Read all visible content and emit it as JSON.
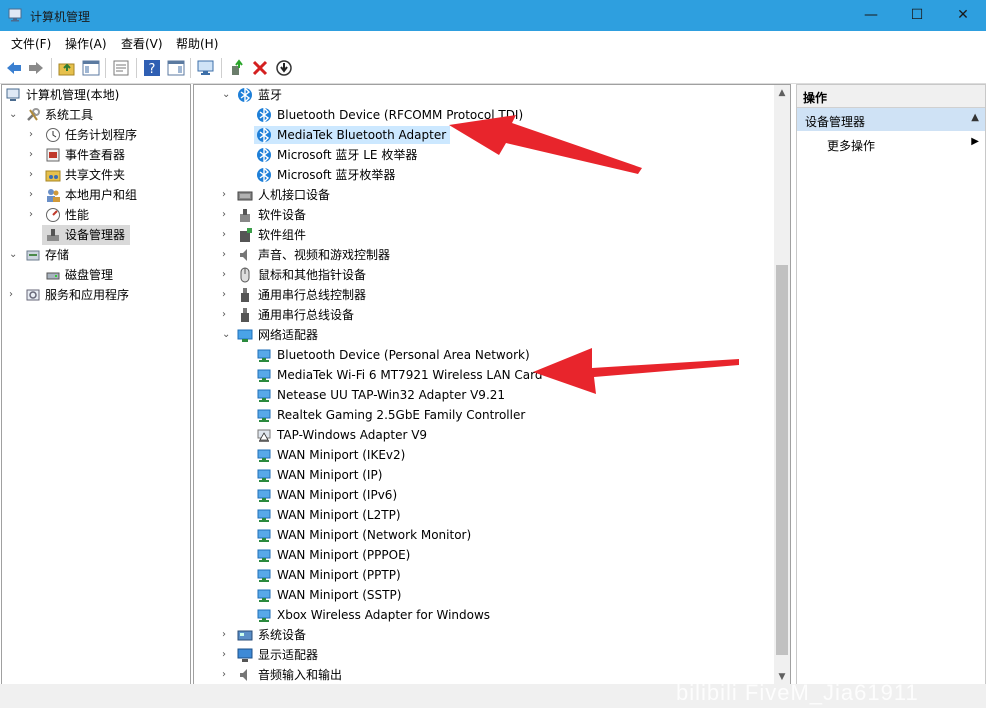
{
  "window": {
    "title": "计算机管理",
    "controls": {
      "minimize": "—",
      "maximize": "☐",
      "close": "✕"
    }
  },
  "menu": [
    "文件(F)",
    "操作(A)",
    "查看(V)",
    "帮助(H)"
  ],
  "left_tree": [
    {
      "label": "计算机管理(本地)",
      "icon": "computer-management-icon"
    },
    {
      "label": "系统工具",
      "icon": "tools-icon"
    },
    {
      "label": "任务计划程序",
      "icon": "clock-icon"
    },
    {
      "label": "事件查看器",
      "icon": "event-viewer-icon"
    },
    {
      "label": "共享文件夹",
      "icon": "shared-folder-icon"
    },
    {
      "label": "本地用户和组",
      "icon": "users-icon"
    },
    {
      "label": "性能",
      "icon": "performance-icon"
    },
    {
      "label": "设备管理器",
      "icon": "device-manager-icon"
    },
    {
      "label": "存储",
      "icon": "storage-icon"
    },
    {
      "label": "磁盘管理",
      "icon": "disk-icon"
    },
    {
      "label": "服务和应用程序",
      "icon": "services-icon"
    }
  ],
  "device_tree": [
    {
      "label": "蓝牙",
      "icon": "bluetooth-icon"
    },
    {
      "label": "Bluetooth Device (RFCOMM Protocol TDI)",
      "icon": "bluetooth-icon"
    },
    {
      "label": "MediaTek Bluetooth Adapter",
      "icon": "bluetooth-icon"
    },
    {
      "label": "Microsoft 蓝牙 LE 枚举器",
      "icon": "bluetooth-icon"
    },
    {
      "label": "Microsoft 蓝牙枚举器",
      "icon": "bluetooth-icon"
    },
    {
      "label": "人机接口设备",
      "icon": "hid-icon"
    },
    {
      "label": "软件设备",
      "icon": "software-device-icon"
    },
    {
      "label": "软件组件",
      "icon": "software-component-icon"
    },
    {
      "label": "声音、视频和游戏控制器",
      "icon": "speaker-icon"
    },
    {
      "label": "鼠标和其他指针设备",
      "icon": "mouse-icon"
    },
    {
      "label": "通用串行总线控制器",
      "icon": "usb-icon"
    },
    {
      "label": "通用串行总线设备",
      "icon": "usb-icon"
    },
    {
      "label": "网络适配器",
      "icon": "network-icon"
    },
    {
      "label": "Bluetooth Device (Personal Area Network)",
      "icon": "network-adapter-icon"
    },
    {
      "label": "MediaTek Wi-Fi 6 MT7921 Wireless LAN Card",
      "icon": "network-adapter-icon"
    },
    {
      "label": "Netease UU TAP-Win32 Adapter V9.21",
      "icon": "network-adapter-icon"
    },
    {
      "label": "Realtek Gaming 2.5GbE Family Controller",
      "icon": "network-adapter-icon"
    },
    {
      "label": "TAP-Windows Adapter V9",
      "icon": "network-adapter-warning-icon"
    },
    {
      "label": "WAN Miniport (IKEv2)",
      "icon": "network-adapter-icon"
    },
    {
      "label": "WAN Miniport (IP)",
      "icon": "network-adapter-icon"
    },
    {
      "label": "WAN Miniport (IPv6)",
      "icon": "network-adapter-icon"
    },
    {
      "label": "WAN Miniport (L2TP)",
      "icon": "network-adapter-icon"
    },
    {
      "label": "WAN Miniport (Network Monitor)",
      "icon": "network-adapter-icon"
    },
    {
      "label": "WAN Miniport (PPPOE)",
      "icon": "network-adapter-icon"
    },
    {
      "label": "WAN Miniport (PPTP)",
      "icon": "network-adapter-icon"
    },
    {
      "label": "WAN Miniport (SSTP)",
      "icon": "network-adapter-icon"
    },
    {
      "label": "Xbox Wireless Adapter for Windows",
      "icon": "network-adapter-icon"
    },
    {
      "label": "系统设备",
      "icon": "system-device-icon"
    },
    {
      "label": "显示适配器",
      "icon": "display-icon"
    },
    {
      "label": "音频输入和输出",
      "icon": "audio-icon"
    }
  ],
  "actions": {
    "header": "操作",
    "section": "设备管理器",
    "more": "更多操作"
  },
  "watermark": "bilibili  FiveM_Jia61911",
  "colors": {
    "titlebar": "#2e9fdf",
    "selection": "#cce8ff",
    "arrow": "#e8252c",
    "bluetooth": "#1e7fd8"
  }
}
